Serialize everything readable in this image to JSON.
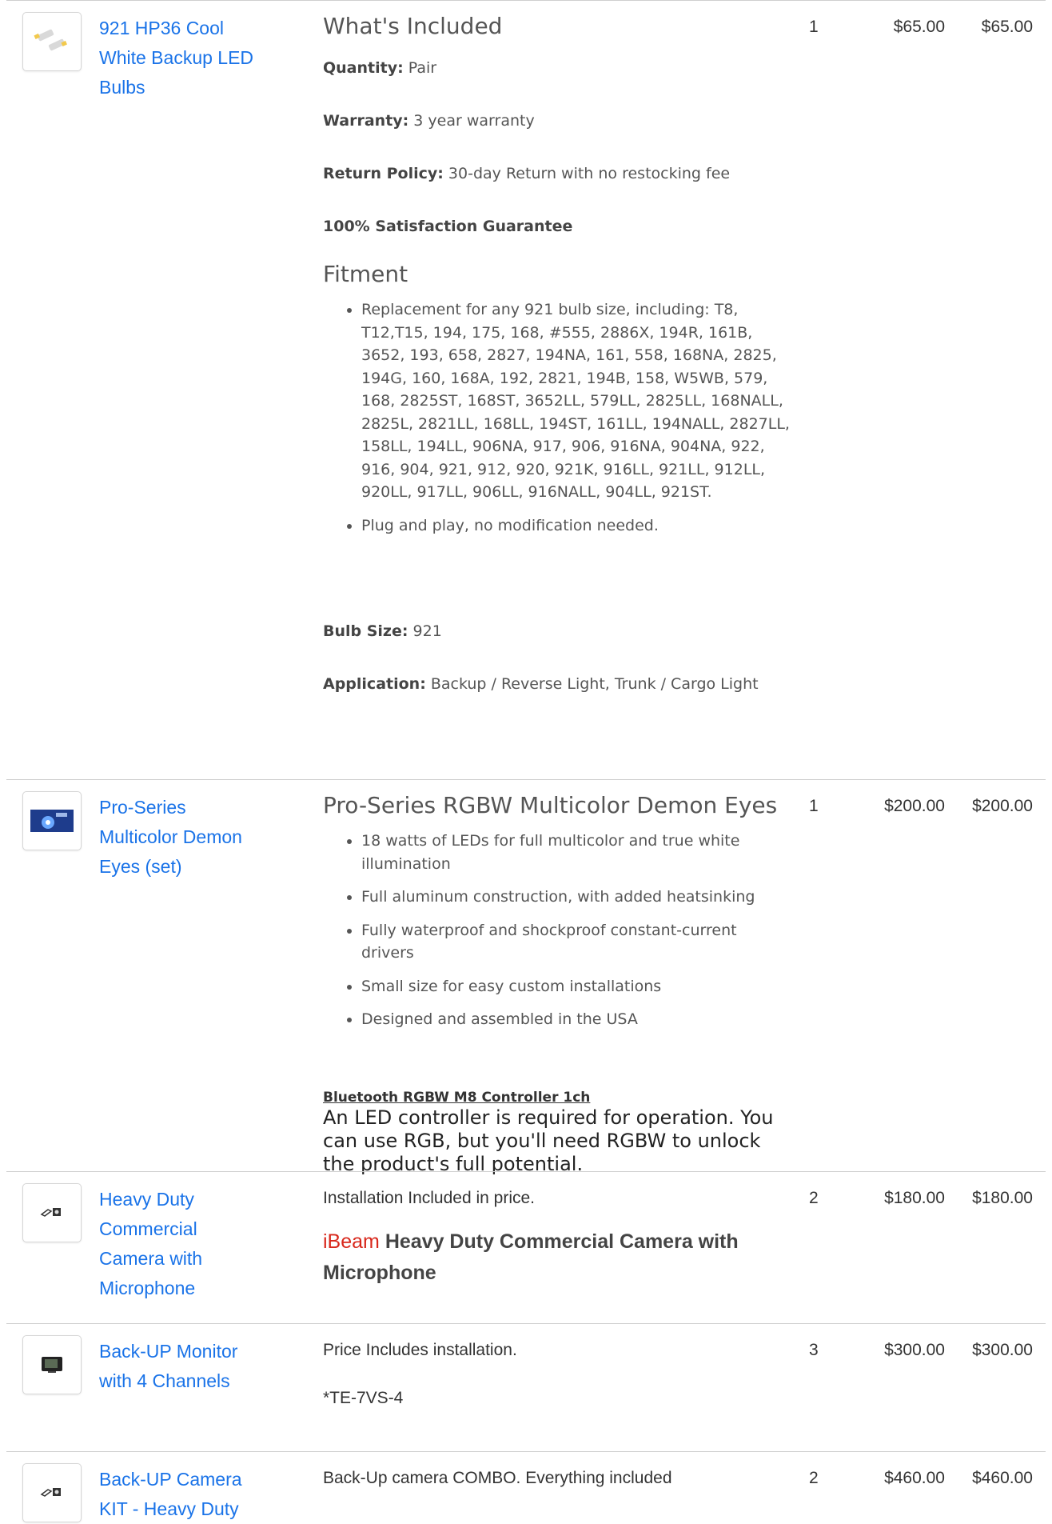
{
  "rows": [
    {
      "name": "921 HP36 Cool White Backup LED Bulbs",
      "qty": "1",
      "price": "$65.00",
      "total": "$65.00",
      "included_heading": "What's Included",
      "quantity_label": "Quantity:",
      "quantity_value": " Pair",
      "warranty_label": "Warranty:",
      "warranty_value": " 3 year warranty",
      "return_label": "Return Policy:",
      "return_value": " 30-day Return with no restocking fee",
      "guarantee": "100% Satisfaction Guarantee",
      "fitment_heading": "Fitment",
      "fitment_items": [
        "Replacement for any 921 bulb size, including: T8, T12,T15, 194, 175, 168, #555, 2886X, 194R, 161B, 3652, 193, 658, 2827, 194NA, 161, 558, 168NA, 2825, 194G, 160, 168A, 192, 2821, 194B, 158, W5WB, 579, 168, 2825ST, 168ST, 3652LL, 579LL, 2825LL, 168NALL, 2825L, 2821LL, 168LL, 194ST, 161LL, 194NALL, 2827LL, 158LL, 194LL, 906NA, 917, 906, 916NA, 904NA, 922, 916, 904, 921, 912, 920, 921K, 916LL, 921LL, 912LL, 920LL, 917LL, 906LL, 916NALL, 904LL, 921ST.",
        "Plug and play, no modification needed."
      ],
      "bulb_label": "Bulb Size:",
      "bulb_value": " 921",
      "app_label": "Application:",
      "app_value": " Backup / Reverse Light, Trunk / Cargo Light"
    },
    {
      "name": "Pro-Series Multicolor Demon Eyes (set)",
      "qty": "1",
      "price": "$200.00",
      "total": "$200.00",
      "heading": "Pro-Series RGBW Multicolor Demon Eyes",
      "features": [
        "18 watts of LEDs for full multicolor and true white illumination",
        "Full aluminum construction, with added heatsinking",
        "Fully waterproof and shockproof constant-current drivers",
        "Small size for easy custom installations",
        "Designed and assembled in the USA"
      ],
      "controller_link": "Bluetooth RGBW M8 Controller 1ch",
      "controller_note": "An LED controller is required for operation. You can use RGB, but you'll need RGBW to unlock the product's full potential."
    },
    {
      "name": "Heavy Duty Commercial Camera with Microphone",
      "qty": "2",
      "price": "$180.00",
      "total": "$180.00",
      "note": "Installation Included in price.",
      "brand": "iBeam",
      "title": " Heavy Duty Commercial Camera with Microphone"
    },
    {
      "name": "Back-UP Monitor with 4 Channels",
      "qty": "3",
      "price": "$300.00",
      "total": "$300.00",
      "note": "Price Includes installation.",
      "sku": "*TE-7VS-4"
    },
    {
      "name": "Back-UP Camera KIT - Heavy Duty",
      "qty": "2",
      "price": "$460.00",
      "total": "$460.00",
      "note": "Back-Up camera COMBO. Everything included"
    }
  ],
  "icons": {
    "row1": "led-bulbs-icon",
    "row2": "demon-eyes-icon",
    "row3": "camera-icon",
    "row4": "monitor-icon",
    "row5": "camera-icon"
  },
  "colors": {
    "link": "#1a73e8",
    "brand_red": "#d8281c",
    "border": "#cfcfcf"
  }
}
